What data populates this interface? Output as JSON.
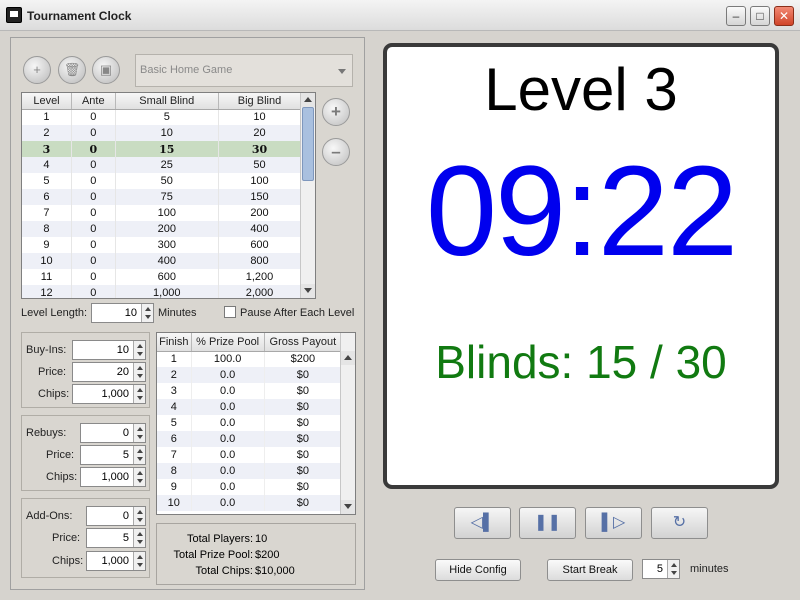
{
  "window": {
    "title": "Tournament Clock"
  },
  "toolbar": {
    "preset": "Basic Home Game"
  },
  "levels": {
    "columns": [
      "Level",
      "Ante",
      "Small Blind",
      "Big Blind"
    ],
    "rows": [
      [
        "1",
        "0",
        "5",
        "10"
      ],
      [
        "2",
        "0",
        "10",
        "20"
      ],
      [
        "3",
        "0",
        "15",
        "30"
      ],
      [
        "4",
        "0",
        "25",
        "50"
      ],
      [
        "5",
        "0",
        "50",
        "100"
      ],
      [
        "6",
        "0",
        "75",
        "150"
      ],
      [
        "7",
        "0",
        "100",
        "200"
      ],
      [
        "8",
        "0",
        "200",
        "400"
      ],
      [
        "9",
        "0",
        "300",
        "600"
      ],
      [
        "10",
        "0",
        "400",
        "800"
      ],
      [
        "11",
        "0",
        "600",
        "1,200"
      ],
      [
        "12",
        "0",
        "1,000",
        "2,000"
      ]
    ],
    "selected_index": 2
  },
  "level_length": {
    "label": "Level Length:",
    "value": "10",
    "unit": "Minutes"
  },
  "pause_after": {
    "label": "Pause After Each Level",
    "checked": false
  },
  "buyins": {
    "count_label": "Buy-Ins:",
    "count": "10",
    "price_label": "Price:",
    "price": "20",
    "chips_label": "Chips:",
    "chips": "1,000"
  },
  "rebuys": {
    "count_label": "Rebuys:",
    "count": "0",
    "price_label": "Price:",
    "price": "5",
    "chips_label": "Chips:",
    "chips": "1,000"
  },
  "addons": {
    "count_label": "Add-Ons:",
    "count": "0",
    "price_label": "Price:",
    "price": "5",
    "chips_label": "Chips:",
    "chips": "1,000"
  },
  "payouts": {
    "columns": [
      "Finish",
      "% Prize Pool",
      "Gross Payout"
    ],
    "rows": [
      [
        "1",
        "100.0",
        "$200"
      ],
      [
        "2",
        "0.0",
        "$0"
      ],
      [
        "3",
        "0.0",
        "$0"
      ],
      [
        "4",
        "0.0",
        "$0"
      ],
      [
        "5",
        "0.0",
        "$0"
      ],
      [
        "6",
        "0.0",
        "$0"
      ],
      [
        "7",
        "0.0",
        "$0"
      ],
      [
        "8",
        "0.0",
        "$0"
      ],
      [
        "9",
        "0.0",
        "$0"
      ],
      [
        "10",
        "0.0",
        "$0"
      ]
    ]
  },
  "summary": {
    "players_label": "Total Players:",
    "players": "10",
    "pool_label": "Total Prize Pool:",
    "pool": "$200",
    "chips_label": "Total Chips:",
    "chips": "$10,000"
  },
  "display": {
    "level": "Level 3",
    "time": "09:22",
    "blinds": "Blinds: 15 / 30"
  },
  "buttons": {
    "hide_config": "Hide Config",
    "start_break": "Start Break",
    "break_minutes": "5",
    "minutes_label": "minutes"
  }
}
